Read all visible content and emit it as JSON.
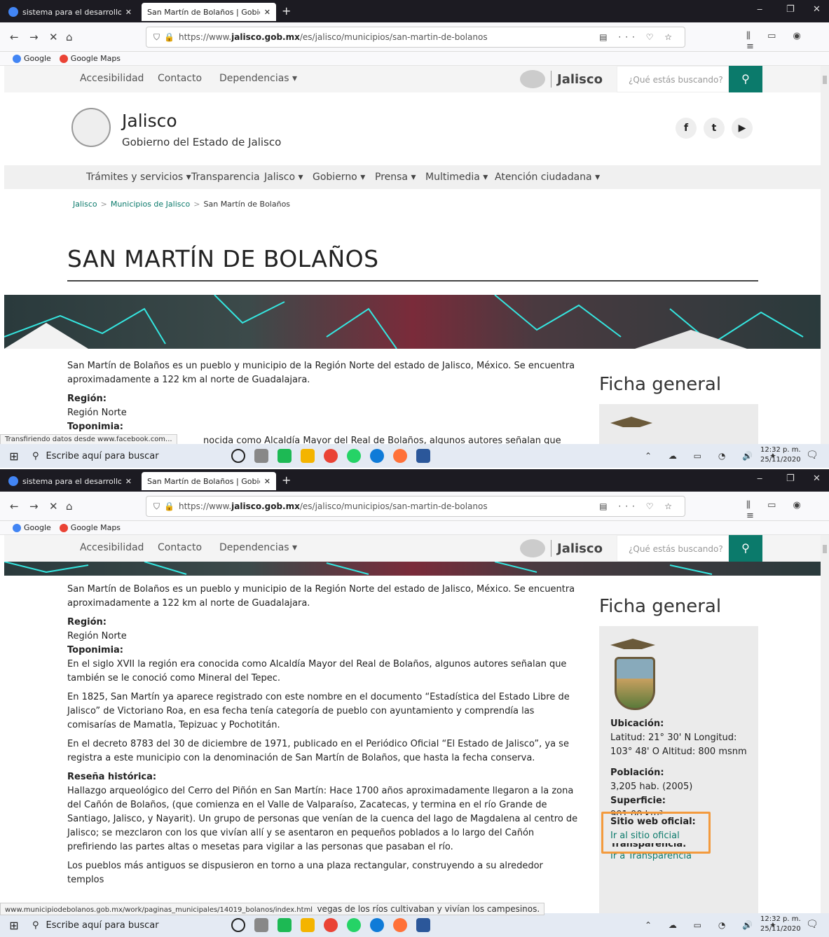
{
  "browser": {
    "tabs": [
      {
        "title": "sistema para el desarrollo integ",
        "close": "✕"
      },
      {
        "title": "San Martín de Bolaños | Gobiern",
        "close": "✕"
      }
    ],
    "new_tab": "+",
    "win_controls": [
      "‒",
      "❐",
      "✕"
    ],
    "url_prefix": "https://www.",
    "url_domain": "jalisco.gob.mx",
    "url_path": "/es/jalisco/municipios/san-martin-de-bolanos",
    "url_icons": "▤ ··· ♡ ☆",
    "right_icons": "⫼ ▭ ◉ ≡",
    "bookmarks": [
      "Google",
      "Google Maps"
    ]
  },
  "site": {
    "top_links": [
      "Accesibilidad",
      "Contacto",
      "Dependencias ▾"
    ],
    "logo_text": "Jalisco",
    "search_placeholder": "¿Qué estás buscando?",
    "search_icon": "🔍",
    "title": "Jalisco",
    "subtitle": "Gobierno del Estado de Jalisco",
    "social": [
      "f",
      "🐦",
      "▶"
    ],
    "nav": [
      "Trámites y servicios ▾",
      "Transparencia",
      "Jalisco ▾",
      "Gobierno ▾",
      "Prensa ▾",
      "Multimedia ▾",
      "Atención ciudadana ▾"
    ],
    "breadcrumb": [
      "Jalisco",
      "Municipios de Jalisco",
      "San Martín de Bolaños"
    ],
    "breadcrumb_sep": ">",
    "page_title": "SAN MARTÍN DE BOLAÑOS"
  },
  "content": {
    "intro": "San Martín de Bolaños es un pueblo y municipio de la Región Norte del estado de Jalisco, México. Se encuentra aproximadamente a 122 km al norte de Guadalajara.",
    "region_label": "Región:",
    "region_value": "Región Norte",
    "toponimia_label": "Toponimia:",
    "toponimia_text": "En el siglo XVII la región era conocida como Alcaldía Mayor del Real de Bolaños, algunos autores señalan que también se le conoció como Mineral del Tepec.",
    "toponimia_partial": "nocida como Alcaldía Mayor del Real de Bolaños, algunos autores señalan que",
    "p1825": "En 1825, San Martín ya aparece registrado con este nombre en el documento “Estadística del Estado Libre de Jalisco” de Victoriano Roa, en esa fecha tenía categoría de pueblo con ayuntamiento y comprendía las comisarías de Mamatla, Tepizuac y Pochotitán.",
    "p1971": "En el decreto 8783 del 30 de diciembre de 1971, publicado en el Periódico Oficial “El Estado de Jalisco”, ya se registra a este municipio con la denominación de San Martín de Bolaños, que hasta la fecha conserva.",
    "resena_label": "Reseña histórica:",
    "resena_text": "Hallazgo arqueológico del Cerro del Piñón en San Martín: Hace 1700 años aproximadamente llegaron a la zona del Cañón de Bolaños, (que comienza en el Valle de Valparaíso, Zacatecas, y termina en el río Grande de Santiago, Jalisco, y Nayarit). Un grupo de personas que venían de la cuenca del lago de Magdalena al centro de Jalisco; se mezclaron con los que vivían allí y se asentaron en pequeños poblados a lo largo del Cañón prefiriendo las partes altas o mesetas para vigilar a las personas que pasaban el río.",
    "pueblos_text": "Los pueblos más antiguos se dispusieron en torno a una plaza rectangular, construyendo a su alrededor templos",
    "vegas_text": "vegas de los ríos cultivaban y vivían los campesinos."
  },
  "ficha": {
    "title": "Ficha general",
    "ubicacion_label": "Ubicación:",
    "ubicacion_value": "Latitud: 21° 30' N Longitud: 103° 48' O Altitud: 800 msnm",
    "poblacion_label": "Población:",
    "poblacion_value": "3,205 hab. (2005)",
    "superficie_label": "Superficie:",
    "superficie_value": "901.00 km²",
    "sitio_label": "Sitio web oficial:",
    "sitio_link": "Ir al sitio oficial",
    "transparencia_label": "Transparencia:",
    "transparencia_link": "Ir a Transparencia"
  },
  "status": {
    "shot1": "Transfiriendo datos desde www.facebook.com...",
    "shot2": "www.municipiodebolanos.gob.mx/work/paginas_municipales/14019_bolanos/index.html"
  },
  "taskbar": {
    "search_placeholder": "Escribe aquí para buscar",
    "tray": "⌃ ☁ ▭ ◔ 🔊 ✦",
    "time": "12:32 p. m.",
    "date": "25/11/2020",
    "notif": "🗨"
  },
  "colors": {
    "accent": "#0b7a6b",
    "highlight": "#f39a3d",
    "tabbar": "#1c1b22"
  }
}
